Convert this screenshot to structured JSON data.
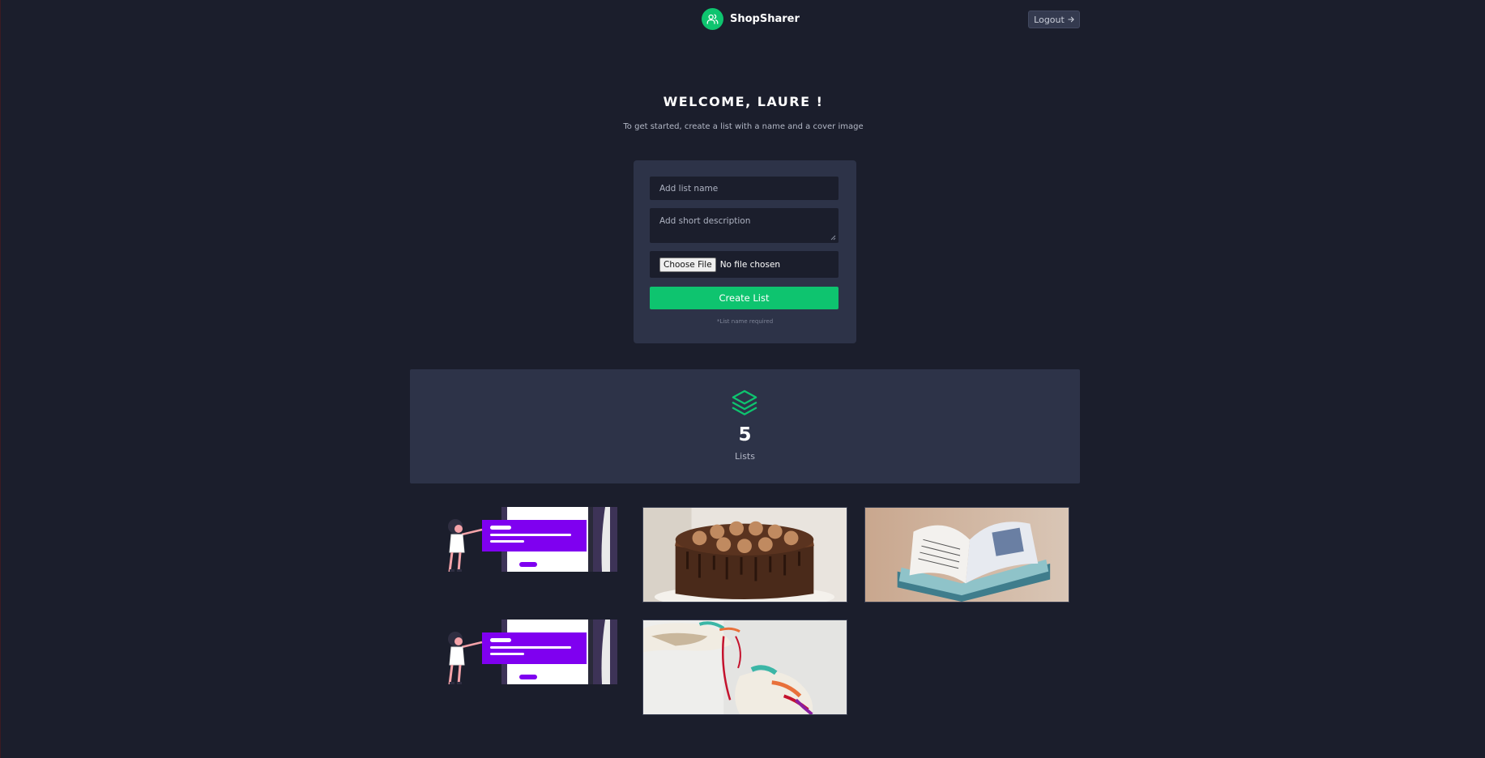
{
  "header": {
    "brand_name": "ShopSharer",
    "logo_icon": "users-icon",
    "logout_label": "Logout",
    "logout_icon": "arrow-right-icon"
  },
  "welcome": {
    "title": "WELCOME, LAURE !",
    "subtitle": "To get started, create a list with a name and a cover image"
  },
  "form": {
    "name_placeholder": "Add list name",
    "description_placeholder": "Add short description",
    "file_button": "Choose File",
    "file_status": "No file chosen",
    "submit_label": "Create List",
    "hint": "*List name required"
  },
  "stats": {
    "icon": "layers-icon",
    "count": "5",
    "label": "Lists"
  },
  "lists": [
    {
      "image": "illustration-person-presenting"
    },
    {
      "image": "chocolate-cake-photo"
    },
    {
      "image": "open-book-photo"
    },
    {
      "image": "illustration-person-presenting"
    },
    {
      "image": "sneakers-photo"
    }
  ],
  "colors": {
    "background": "#1b1e2c",
    "card": "#2d3348",
    "accent": "#0ec46f",
    "illustration_purple": "#7f00f0"
  }
}
